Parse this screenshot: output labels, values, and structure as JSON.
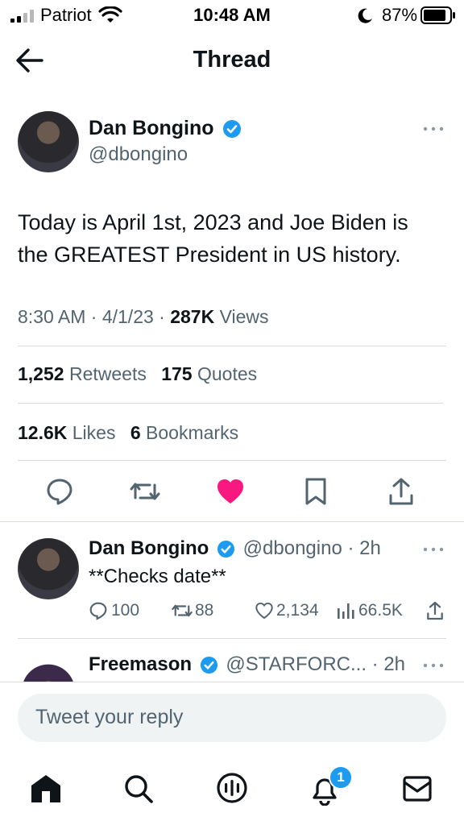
{
  "status_bar": {
    "carrier": "Patriot",
    "time": "10:48 AM",
    "battery": "87%"
  },
  "header": {
    "title": "Thread"
  },
  "main_tweet": {
    "name": "Dan Bongino",
    "handle": "@dbongino",
    "text_line1": "Today is April 1st, 2023 and Joe Biden is",
    "text_line2": "the GREATEST President in US history.",
    "meta_time": "8:30 AM · 4/1/23 · ",
    "views_count": "287K",
    "views_label": " Views",
    "retweets_count": "1,252",
    "retweets_label": "Retweets",
    "quotes_count": "175",
    "quotes_label": "Quotes",
    "likes_count": "12.6K",
    "likes_label": "Likes",
    "bookmarks_count": "6",
    "bookmarks_label": "Bookmarks",
    "like_color": "#f91880"
  },
  "reply_tweet": {
    "name": "Dan Bongino",
    "handle_time": "@dbongino · 2h",
    "text": "**Checks date**",
    "replies": "100",
    "retweets": "88",
    "likes": "2,134",
    "views": "66.5K"
  },
  "next_tweet": {
    "name": "Freemason",
    "handle_time": "@STARFORC... · 2h"
  },
  "reply_input": {
    "placeholder": "Tweet your reply"
  },
  "bottom_nav": {
    "notifications_badge": "1"
  },
  "colors": {
    "accent": "#1d9bf0",
    "muted": "#536471"
  }
}
